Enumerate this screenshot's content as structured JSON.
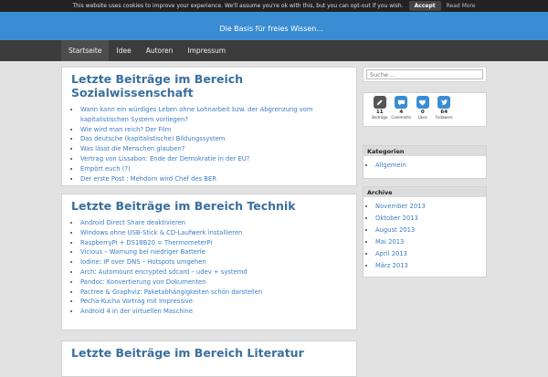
{
  "cookie": {
    "text": "This website uses cookies to improve your experience. We'll assume you're ok with this, but you can opt-out if you wish.",
    "accept": "Accept",
    "read_more": "Read More"
  },
  "header": {
    "tagline": "Die Basis für freies Wissen..."
  },
  "nav": [
    "Startseite",
    "Idee",
    "Autoren",
    "Impressum"
  ],
  "sections": [
    {
      "title": "Letzte Beiträge im Bereich Sozialwissenschaft",
      "items": [
        "Wann kann ein würdiges Leben ohne Lohnarbeit bzw. der Abgrenzung vom kapitalistischen System vorliegen?",
        "Wie wird man reich? Der Film",
        "Das deutsche (kapitalistische) Bildungssystem",
        "Was lässt die Menschen glauben?",
        "Vertrag von Lissabon: Ende der Demokratie in der EU?",
        "Empört euch (?)",
        "Der erste Post : Mehdorn wird Chef des BER"
      ]
    },
    {
      "title": "Letzte Beiträge im Bereich Technik",
      "items": [
        "Android Direct Share deaktivieren",
        "Windows ohne USB-Stick & CD-Laufwerk installieren",
        "RaspberryPi + DS18B20 = ThermometerPi",
        "Vicious – Warnung bei niedriger Batterie",
        "Iodine: IP over DNS – Hotspots umgehen",
        "Arch: Automount encrypted sdcard – udev + systemd",
        "Pandoc: Konvertierung von Dokumenten",
        "Pactree & Graphviz: Paketabhängigkeiten schön darstellen",
        "Pecha-Kucha Vortrag mit Impressive",
        "Android 4 in der virtuellen Maschine"
      ]
    },
    {
      "title": "Letzte Beiträge im Bereich Literatur",
      "items": []
    }
  ],
  "sidebar": {
    "search_placeholder": "Suche …",
    "stats": [
      {
        "icon": "pencil-icon",
        "count": "11",
        "label": "Beiträge",
        "color": "#555555"
      },
      {
        "icon": "comments-icon",
        "count": "4",
        "label": "Comments",
        "color": "#3b8dd3"
      },
      {
        "icon": "likes-icon",
        "count": "0",
        "label": "Likes",
        "color": "#3b8dd3"
      },
      {
        "icon": "twitter-icon",
        "count": "64",
        "label": "Followers",
        "color": "#3b8dd3"
      }
    ],
    "categories_title": "Kategorien",
    "categories": [
      "Allgemein"
    ],
    "archive_title": "Archive",
    "archive": [
      "November 2013",
      "Oktober 2013",
      "August 2013",
      "Mai 2013",
      "April 2013",
      "März 2013"
    ]
  }
}
